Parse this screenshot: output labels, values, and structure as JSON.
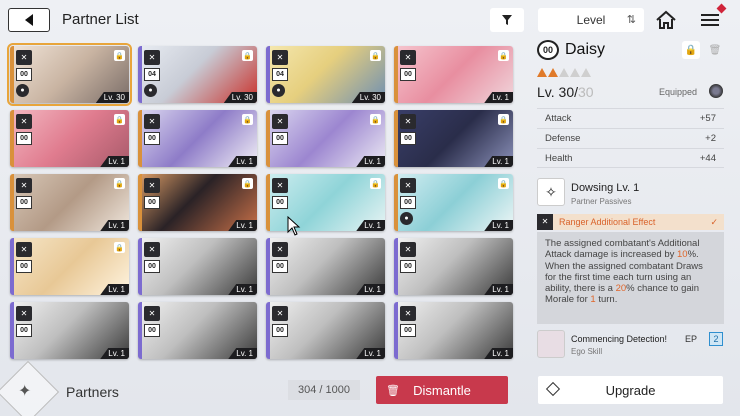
{
  "header": {
    "title": "Partner List",
    "sort_label": "Level",
    "icons": [
      "back-arrow-icon",
      "filter-icon",
      "sort-order-icon",
      "home-icon",
      "menu-icon"
    ]
  },
  "cards": [
    {
      "num": "00",
      "level": "Lv. 30",
      "lock": true,
      "stripe": "#d9913b",
      "art": "linear-gradient(135deg,#f0e4d8 0%,#c9b4a2 50%,#7a6d68 100%)",
      "selected": true,
      "badge2": "round"
    },
    {
      "num": "04",
      "level": "Lv. 30",
      "lock": true,
      "stripe": "#7c6bd0",
      "art": "linear-gradient(135deg,#e8ecf2 0%,#c8ccd6 45%,#c9312b 100%)",
      "selected": false,
      "badge2": "round"
    },
    {
      "num": "04",
      "level": "Lv. 30",
      "lock": true,
      "stripe": "#7c6bd0",
      "art": "linear-gradient(135deg,#f5e8b0 0%,#e6cf7e 45%,#6f8fb2 100%)",
      "selected": false,
      "badge2": "round"
    },
    {
      "num": "00",
      "level": "Lv. 1",
      "lock": true,
      "stripe": "#d9913b",
      "art": "linear-gradient(135deg,#f6c6cf 0%,#e88ea0 50%,#f0d6dc 100%)",
      "selected": false,
      "badge2": ""
    },
    {
      "num": "00",
      "level": "Lv. 1",
      "lock": true,
      "stripe": "#d9913b",
      "art": "linear-gradient(135deg,#f3b8c2 0%,#e07c8f 50%,#a85a6a 100%)",
      "selected": false,
      "badge2": ""
    },
    {
      "num": "00",
      "level": "Lv. 1",
      "lock": true,
      "stripe": "#d9913b",
      "art": "linear-gradient(135deg,#dcd8f0 0%,#8e7cc8 50%,#f2f0f6 100%)",
      "selected": false,
      "badge2": ""
    },
    {
      "num": "00",
      "level": "Lv. 1",
      "lock": true,
      "stripe": "#d9913b",
      "art": "linear-gradient(135deg,#dcd8f0 0%,#9c86d0 50%,#eceaf4 100%)",
      "selected": false,
      "badge2": ""
    },
    {
      "num": "00",
      "level": "Lv. 1",
      "lock": true,
      "stripe": "#d9913b",
      "art": "linear-gradient(135deg,#3a3f6a 0%,#2a2d4a 50%,#8a90b8 100%)",
      "selected": false,
      "badge2": ""
    },
    {
      "num": "00",
      "level": "Lv. 1",
      "lock": true,
      "stripe": "#d9913b",
      "art": "linear-gradient(135deg,#d8c8b8 0%,#b39a86 50%,#efe6dc 100%)",
      "selected": false,
      "badge2": ""
    },
    {
      "num": "00",
      "level": "Lv. 1",
      "lock": true,
      "stripe": "#d9913b",
      "art": "linear-gradient(135deg,#e0a068 0%,#2a2226 45%,#c87048 100%)",
      "selected": false,
      "badge2": ""
    },
    {
      "num": "00",
      "level": "Lv. 1",
      "lock": true,
      "stripe": "#d9913b",
      "art": "linear-gradient(135deg,#cfeef0 0%,#8fd4d8 50%,#e8f4f4 100%)",
      "selected": false,
      "badge2": ""
    },
    {
      "num": "00",
      "level": "Lv. 1",
      "lock": true,
      "stripe": "#d9913b",
      "art": "linear-gradient(135deg,#d4eef2 0%,#8ccfd6 50%,#eef6f6 100%)",
      "selected": false,
      "badge2": "round"
    },
    {
      "num": "00",
      "level": "Lv. 1",
      "lock": true,
      "stripe": "#7c6bd0",
      "art": "linear-gradient(135deg,#f6e6c8 0%,#e8c896 50%,#fff4e0 100%)",
      "selected": false,
      "badge2": ""
    },
    {
      "num": "00",
      "level": "Lv. 1",
      "lock": false,
      "stripe": "#7c6bd0",
      "art": "linear-gradient(135deg,#f2f2f2 0%,#bfbfbf 45%,#3a3a3a 100%)",
      "selected": false,
      "badge2": ""
    },
    {
      "num": "00",
      "level": "Lv. 1",
      "lock": false,
      "stripe": "#7c6bd0",
      "art": "linear-gradient(135deg,#f2f2f2 0%,#bfbfbf 45%,#3a3a3a 100%)",
      "selected": false,
      "badge2": ""
    },
    {
      "num": "00",
      "level": "Lv. 1",
      "lock": false,
      "stripe": "#7c6bd0",
      "art": "linear-gradient(135deg,#f2f2f2 0%,#bfbfbf 45%,#3a3a3a 100%)",
      "selected": false,
      "badge2": ""
    },
    {
      "num": "00",
      "level": "Lv. 1",
      "lock": false,
      "stripe": "#7c6bd0",
      "art": "linear-gradient(135deg,#f2f2f2 0%,#bfbfbf 45%,#3a3a3a 100%)",
      "selected": false,
      "badge2": ""
    },
    {
      "num": "00",
      "level": "Lv. 1",
      "lock": false,
      "stripe": "#7c6bd0",
      "art": "linear-gradient(135deg,#f2f2f2 0%,#bfbfbf 45%,#3a3a3a 100%)",
      "selected": false,
      "badge2": ""
    },
    {
      "num": "00",
      "level": "Lv. 1",
      "lock": false,
      "stripe": "#7c6bd0",
      "art": "linear-gradient(135deg,#f2f2f2 0%,#bfbfbf 45%,#3a3a3a 100%)",
      "selected": false,
      "badge2": ""
    },
    {
      "num": "00",
      "level": "Lv. 1",
      "lock": false,
      "stripe": "#7c6bd0",
      "art": "linear-gradient(135deg,#f2f2f2 0%,#bfbfbf 45%,#3a3a3a 100%)",
      "selected": false,
      "badge2": ""
    }
  ],
  "detail": {
    "num": "00",
    "name": "Daisy",
    "stars_filled": 2,
    "stars_total": 5,
    "level": "Lv. 30/",
    "level_max": "30",
    "equipped_label": "Equipped",
    "stats": [
      {
        "label": "Attack",
        "value": "+57"
      },
      {
        "label": "Defense",
        "value": "+2"
      },
      {
        "label": "Health",
        "value": "+44"
      }
    ],
    "skill_name": "Dowsing Lv. 1",
    "skill_sub": "Partner Passives",
    "effect_label": "Ranger Additional Effect",
    "desc": {
      "t1": "The assigned combatant's Additional Attack damage is increased by ",
      "h1": "10",
      "t2": "%. When the assigned combatant Draws for the first time each turn using an ability, there is a ",
      "h2": "20",
      "t3": "% chance to gain Morale for ",
      "h3": "1",
      "t4": " turn."
    },
    "ego_name": "Commencing Detection!",
    "ego_sub": "Ego Skill",
    "ep_label": "EP",
    "ep_value": "2"
  },
  "bottom": {
    "partners_label": "Partners",
    "count": "304 / 1000",
    "dismantle_label": "Dismantle",
    "upgrade_label": "Upgrade"
  },
  "colors": {
    "accent_orange": "#e07a2a",
    "dismantle_red": "#c8394c",
    "ep_blue": "#1f6fa8"
  }
}
